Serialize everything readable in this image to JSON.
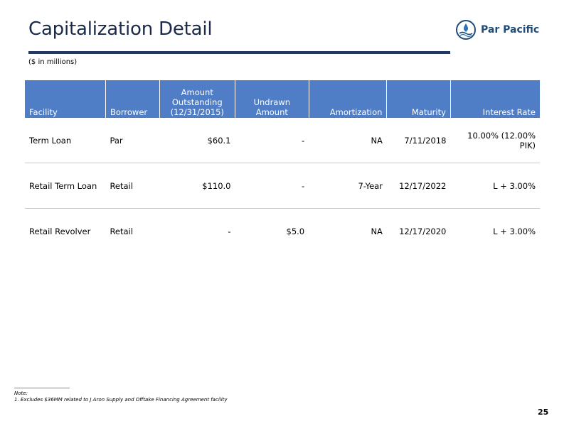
{
  "header": {
    "title": "Capitalization Detail",
    "subtitle": "($ in millions)",
    "logo_text": "Par Pacific"
  },
  "table": {
    "columns": [
      "Facility",
      "Borrower",
      "Amount Outstanding (12/31/2015)",
      "Undrawn Amount",
      "Amortization",
      "Maturity",
      "Interest Rate"
    ],
    "column_lines": {
      "amount": [
        "Amount",
        "Outstanding",
        "(12/31/2015)"
      ]
    },
    "rows": [
      [
        "Term Loan",
        "Par",
        "$60.1",
        "-",
        "NA",
        "7/11/2018",
        "10.00% (12.00% PIK)"
      ],
      [
        "Retail Term Loan",
        "Retail",
        "$110.0",
        "-",
        "7-Year",
        "12/17/2022",
        "L + 3.00%"
      ],
      [
        "Retail Revolver",
        "Retail",
        "-",
        "$5.0",
        "NA",
        "12/17/2020",
        "L + 3.00%"
      ]
    ]
  },
  "footer": {
    "note_label": "Note:",
    "note_text": "1. Excludes $36MM related to J Aron Supply and Offtake Financing Agreement facility",
    "page_number": "25"
  },
  "colors": {
    "header_fill": "#4f7ec6",
    "title_rule": "#1f3864",
    "title_text": "#1b2a49"
  }
}
